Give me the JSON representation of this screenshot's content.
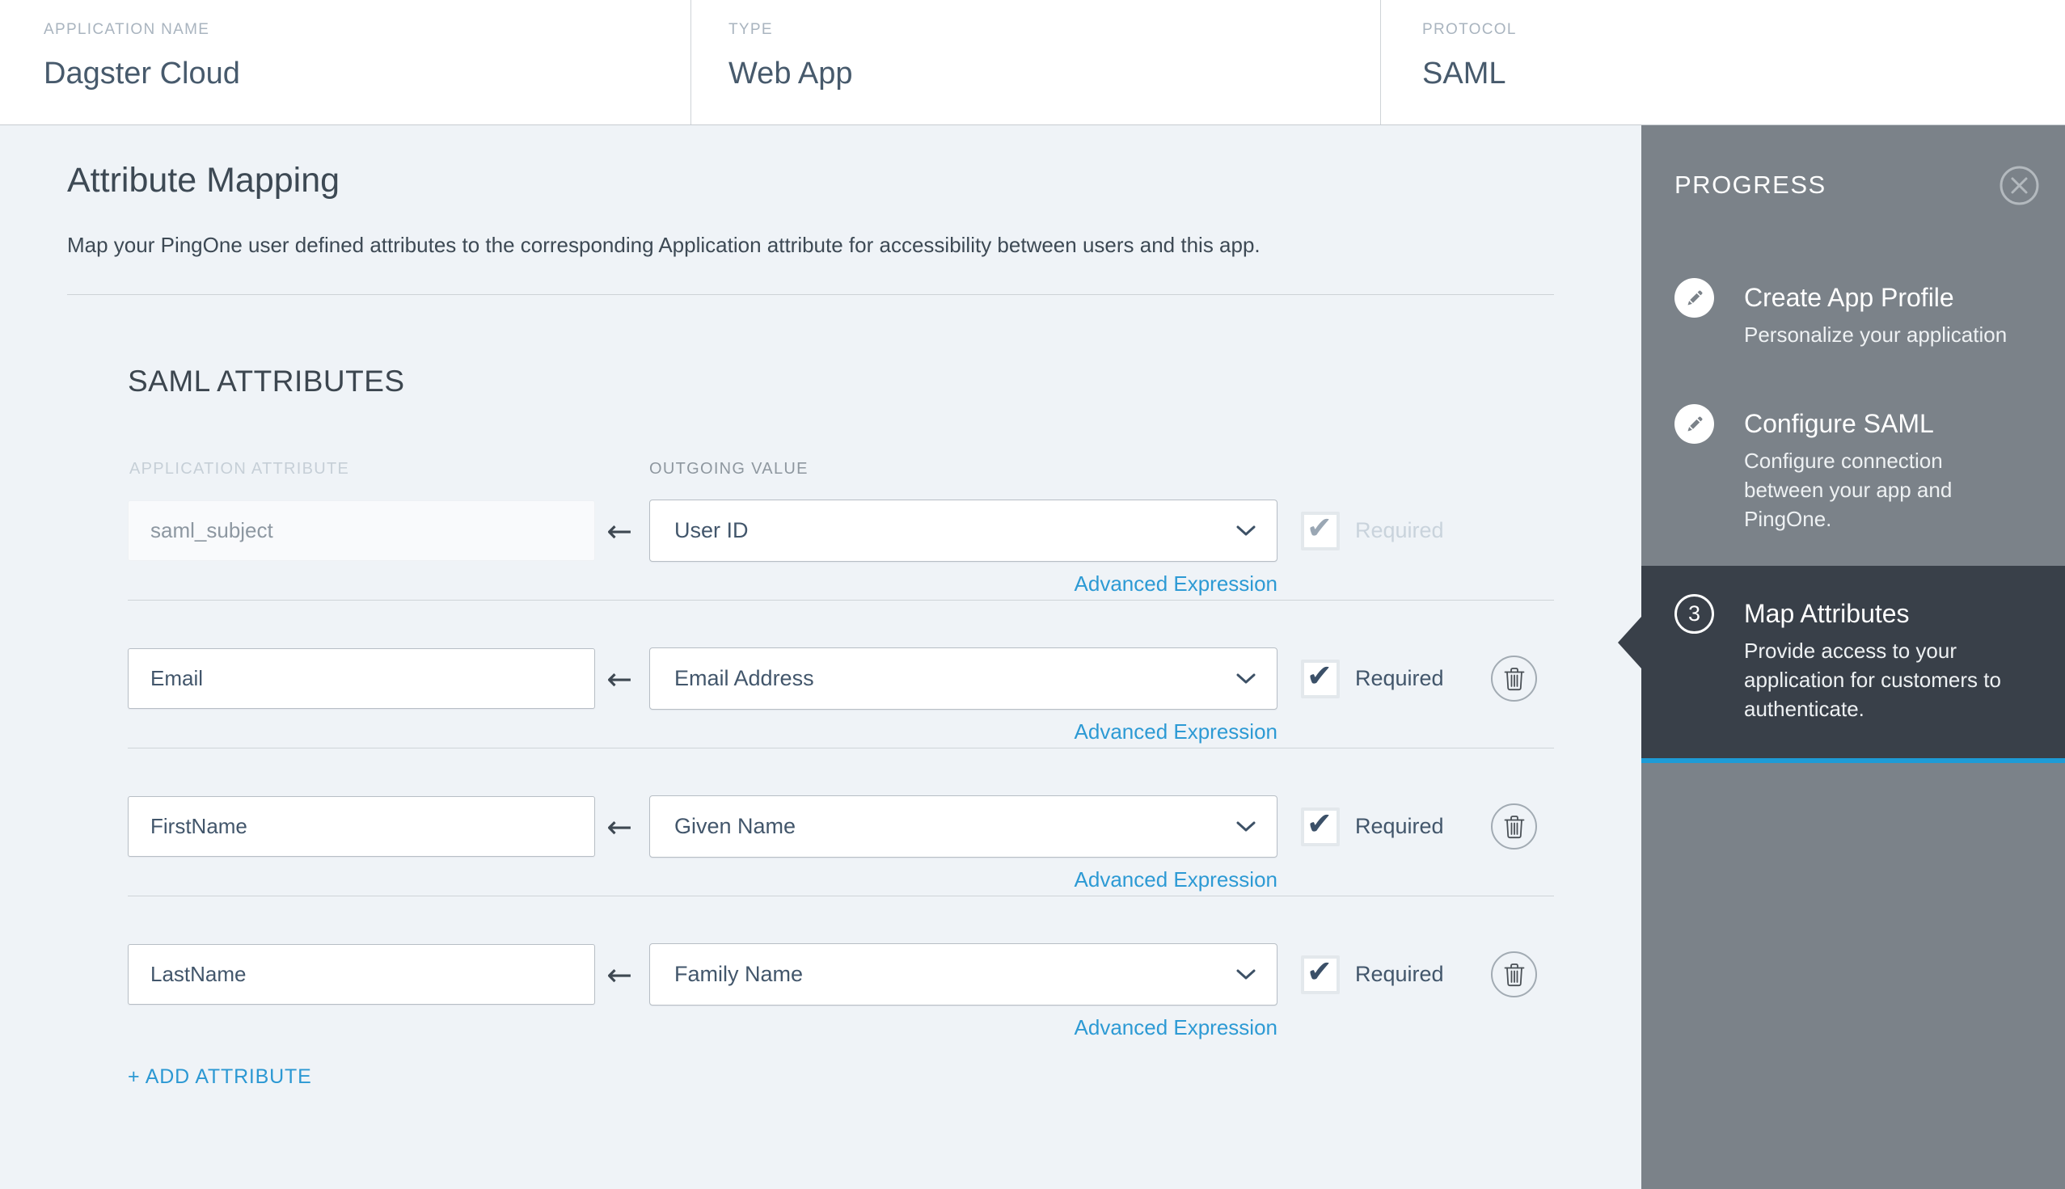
{
  "header": {
    "columns": [
      {
        "label": "APPLICATION NAME",
        "value": "Dagster Cloud"
      },
      {
        "label": "TYPE",
        "value": "Web App"
      },
      {
        "label": "PROTOCOL",
        "value": "SAML"
      }
    ]
  },
  "main": {
    "title": "Attribute Mapping",
    "description": "Map your PingOne user defined attributes to the corresponding Application attribute for accessibility between users and this app.",
    "section_title": "SAML ATTRIBUTES",
    "column_headers": {
      "application_attribute": "APPLICATION ATTRIBUTE",
      "outgoing_value": "OUTGOING VALUE"
    },
    "advanced_expression_label": "Advanced Expression",
    "required_label": "Required",
    "add_attribute_label": "+ ADD ATTRIBUTE",
    "rows": [
      {
        "application_attribute": "saml_subject",
        "outgoing_value": "User ID",
        "required": true,
        "disabled": true,
        "deletable": false
      },
      {
        "application_attribute": "Email",
        "outgoing_value": "Email Address",
        "required": true,
        "disabled": false,
        "deletable": true
      },
      {
        "application_attribute": "FirstName",
        "outgoing_value": "Given Name",
        "required": true,
        "disabled": false,
        "deletable": true
      },
      {
        "application_attribute": "LastName",
        "outgoing_value": "Family Name",
        "required": true,
        "disabled": false,
        "deletable": true
      }
    ]
  },
  "progress_panel": {
    "title": "PROGRESS",
    "steps": [
      {
        "icon": "pencil-icon",
        "title": "Create App Profile",
        "description": "Personalize your application",
        "status": "completed"
      },
      {
        "icon": "pencil-icon",
        "title": "Configure SAML",
        "description": "Configure connection between your app and PingOne.",
        "status": "completed"
      },
      {
        "number": "3",
        "title": "Map Attributes",
        "description": "Provide access to your application for customers to authenticate.",
        "status": "active"
      }
    ]
  },
  "colors": {
    "link_blue": "#2d9ad4",
    "active_step_underline": "#1d9bd6",
    "sidebar_bg": "#7b8289",
    "active_step_bg": "#394049",
    "content_bg": "#eff3f7"
  }
}
